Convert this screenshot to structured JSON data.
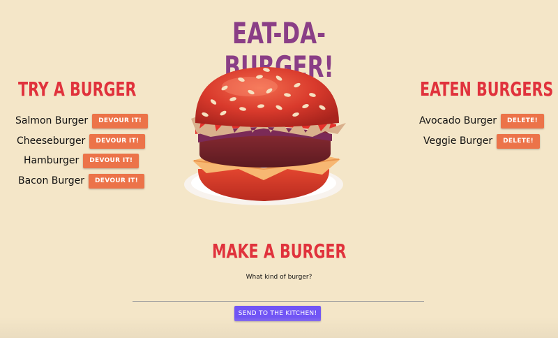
{
  "header": {
    "title": "EAT-DA-BURGER!"
  },
  "try_section": {
    "heading": "TRY A BURGER",
    "button_label": "DEVOUR IT!",
    "items": [
      {
        "name": "Salmon Burger"
      },
      {
        "name": "Cheeseburger"
      },
      {
        "name": "Hamburger"
      },
      {
        "name": "Bacon Burger"
      }
    ]
  },
  "eaten_section": {
    "heading": "EATEN BURGERS",
    "button_label": "DELETE!",
    "items": [
      {
        "name": "Avocado Burger"
      },
      {
        "name": "Veggie Burger"
      }
    ]
  },
  "make_section": {
    "heading": "MAKE A BURGER",
    "prompt": "What kind of burger?",
    "input_value": "",
    "submit_label": "SEND TO THE KITCHEN!"
  },
  "colors": {
    "background": "#f4e6c8",
    "title": "#8a3e86",
    "heading": "#e0323c",
    "action_button": "#ec7349",
    "submit_button": "#7155f5"
  },
  "icons": {
    "hero": "burger-illustration"
  }
}
